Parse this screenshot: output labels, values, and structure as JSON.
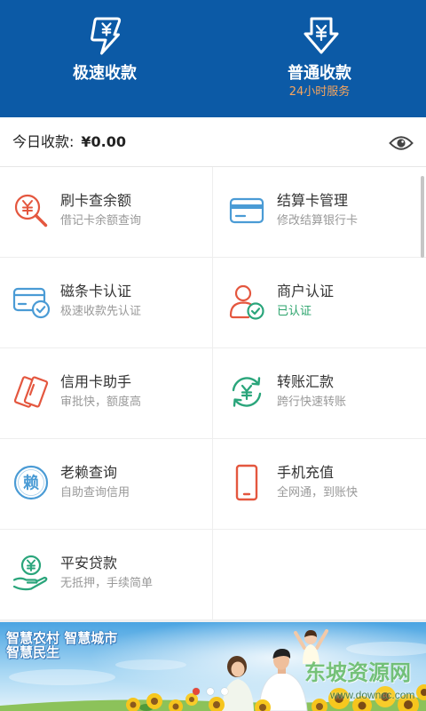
{
  "colors": {
    "brand": "#0c5aa6",
    "header_sub": "#f7a55e",
    "red_icon": "#e4573f",
    "blue_icon": "#4a9bd5",
    "green_icon": "#2aa57b",
    "verified": "#2aa36b",
    "title_text": "#333333",
    "sub_text": "#999999",
    "pager_active": "#e5483a"
  },
  "header": {
    "fast": {
      "label": "极速收款",
      "icon": "yen-lightning-icon"
    },
    "normal": {
      "label": "普通收款",
      "sub": "24小时服务",
      "icon": "yen-download-icon"
    }
  },
  "today": {
    "label": "今日收款:",
    "amount": "¥0.00",
    "toggle_icon": "eye-icon"
  },
  "services": [
    {
      "title": "刷卡查余额",
      "sub": "借记卡余额查询",
      "icon": "yen-search-icon"
    },
    {
      "title": "结算卡管理",
      "sub": "修改结算银行卡",
      "icon": "bank-card-icon"
    },
    {
      "title": "磁条卡认证",
      "sub": "极速收款先认证",
      "icon": "card-verify-icon"
    },
    {
      "title": "商户认证",
      "sub": "已认证",
      "icon": "merchant-verify-icon"
    },
    {
      "title": "信用卡助手",
      "sub": "审批快，额度高",
      "icon": "credit-cards-icon"
    },
    {
      "title": "转账汇款",
      "sub": "跨行快速转账",
      "icon": "transfer-icon"
    },
    {
      "title": "老赖查询",
      "sub": "自助查询信用",
      "icon": "laolai-icon",
      "icon_glyph": "赖"
    },
    {
      "title": "手机充值",
      "sub": "全网通，到账快",
      "icon": "mobile-phone-icon"
    },
    {
      "title": "平安贷款",
      "sub": "无抵押，手续简单",
      "icon": "hand-coin-icon"
    }
  ],
  "banner": {
    "line1": "智慧农村 智慧城市",
    "line2": "智慧民生",
    "pager": {
      "total": 3,
      "active": 1
    },
    "watermark": "东坡资源网",
    "watermark_url": "www.downcc.com"
  }
}
